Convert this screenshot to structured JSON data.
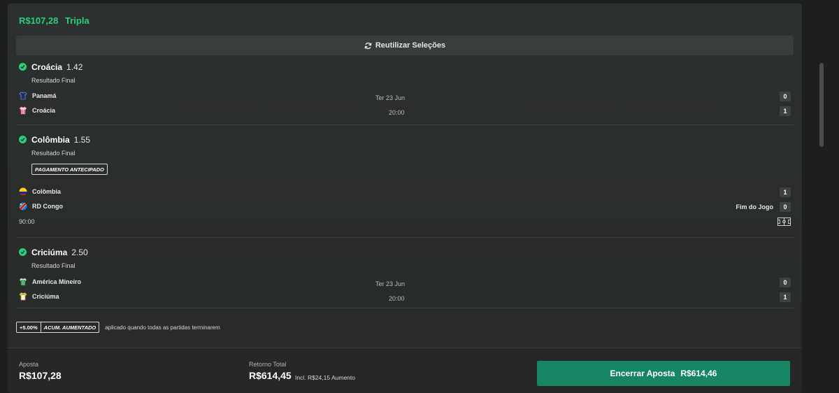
{
  "bet": {
    "stake_amount": "R$107,28",
    "bet_type": "Tripla"
  },
  "reuse_label": "Reutilizar Seleções",
  "selections": [
    {
      "pick": "Croácia",
      "odds": "1.42",
      "market": "Resultado Final",
      "home_team": "Panamá",
      "away_team": "Croácia",
      "date": "Ter 23 Jun",
      "time": "20:00",
      "home_score": "0",
      "away_score": "1"
    },
    {
      "pick": "Colômbia",
      "odds": "1.55",
      "market": "Resultado Final",
      "badge": "PAGAMENTO ANTECIPADO",
      "home_team": "Colômbia",
      "away_team": "RD Congo",
      "status": "Fim do Jogo",
      "clock": "90:00",
      "home_score": "1",
      "away_score": "0"
    },
    {
      "pick": "Criciúma",
      "odds": "2.50",
      "market": "Resultado Final",
      "home_team": "América Mineiro",
      "away_team": "Criciúma",
      "date": "Ter 23 Jun",
      "time": "20:00",
      "home_score": "0",
      "away_score": "1"
    }
  ],
  "boost": {
    "percent": "+5.00%",
    "label": "ACUM. AUMENTADO",
    "note": "aplicado quando todas as partidas terminarem"
  },
  "footer": {
    "stake_label": "Aposta",
    "stake_value": "R$107,28",
    "return_label": "Retorno Total",
    "return_value": "R$614,45",
    "return_note": "Incl. R$24,15 Aumento",
    "cashout_label": "Encerrar Aposta",
    "cashout_amount": "R$614,46"
  },
  "colors": {
    "accent": "#26d07c",
    "cashout_button": "#178563",
    "background": "#2c302e"
  }
}
